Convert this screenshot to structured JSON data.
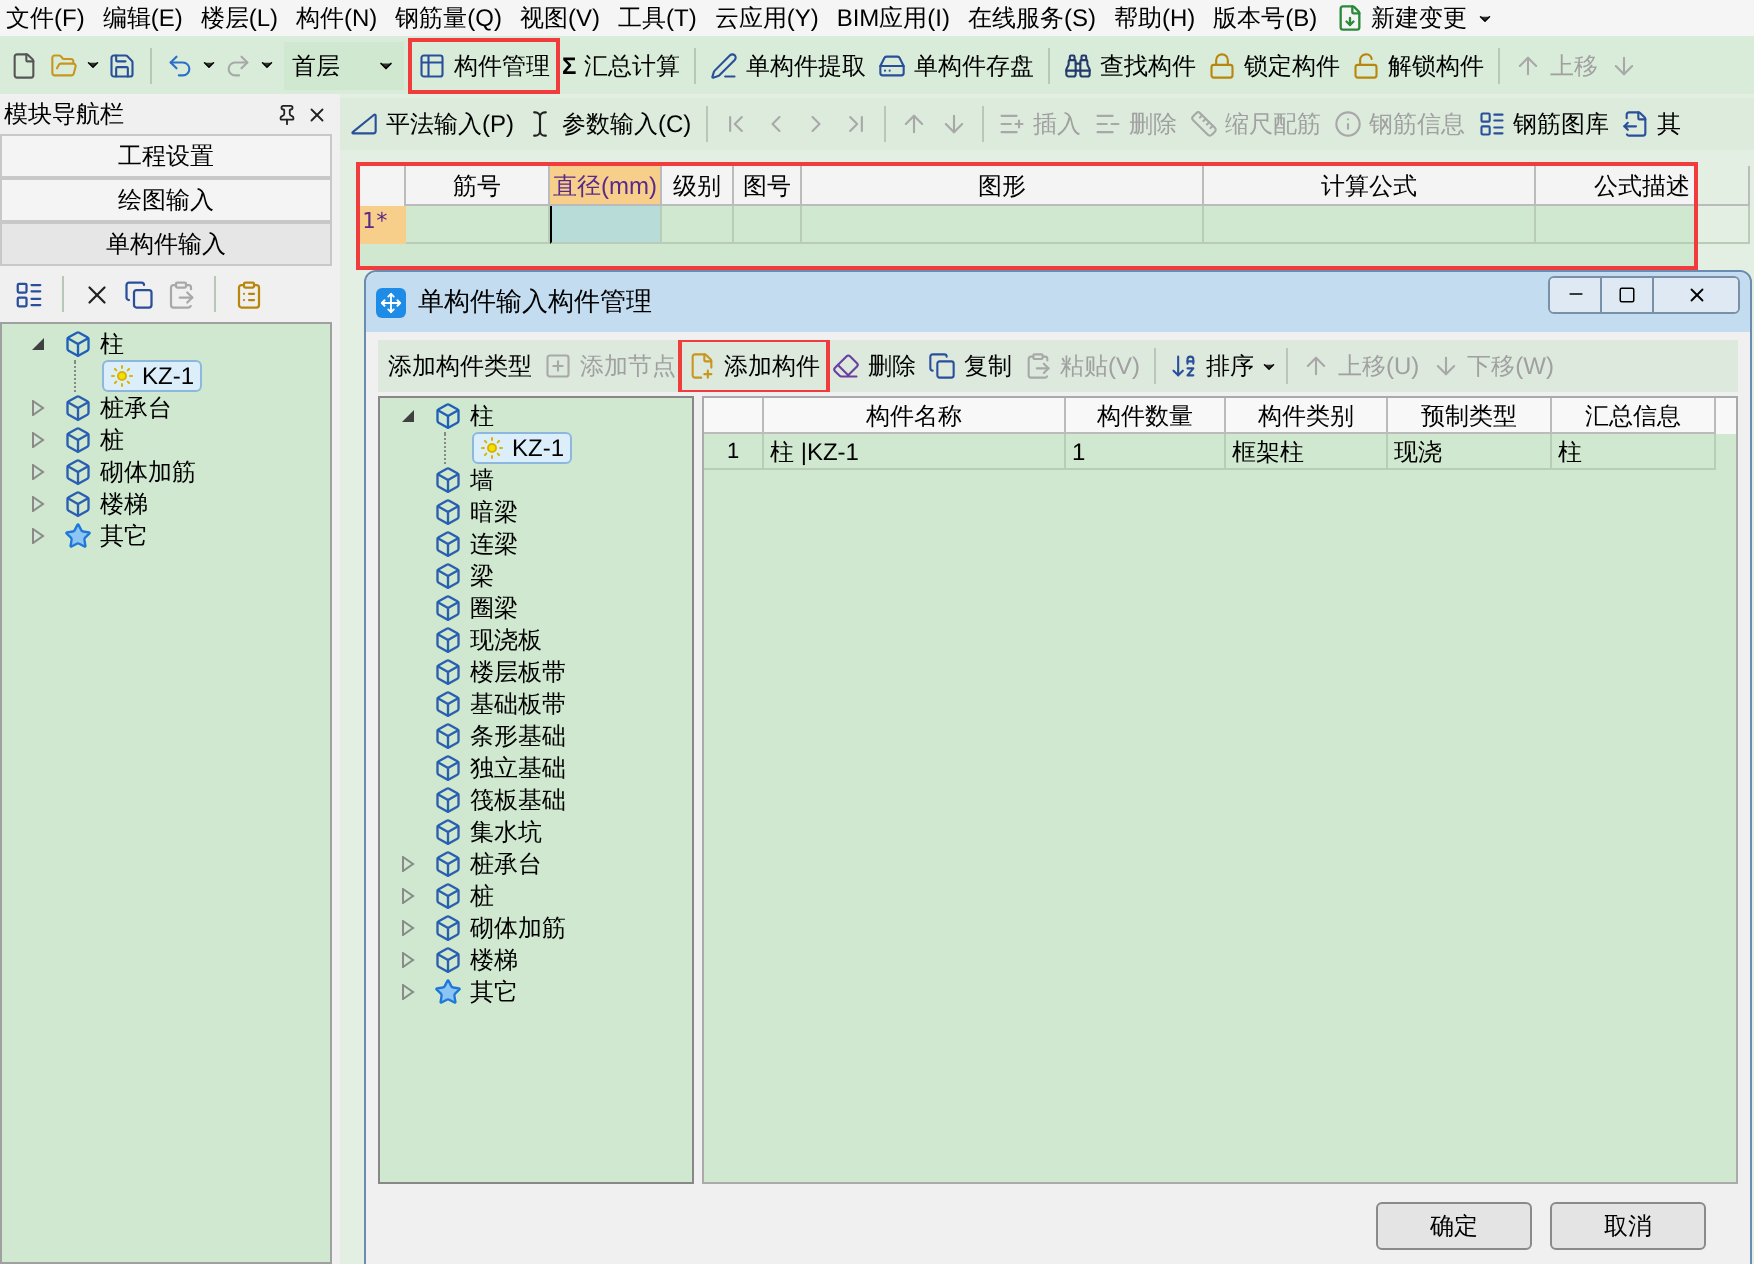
{
  "menu": [
    {
      "label": "文件(F)"
    },
    {
      "label": "编辑(E)"
    },
    {
      "label": "楼层(L)"
    },
    {
      "label": "构件(N)"
    },
    {
      "label": "钢筋量(Q)"
    },
    {
      "label": "视图(V)"
    },
    {
      "label": "工具(T)"
    },
    {
      "label": "云应用(Y)"
    },
    {
      "label": "BIM应用(I)"
    },
    {
      "label": "在线服务(S)"
    },
    {
      "label": "帮助(H)"
    },
    {
      "label": "版本号(B)"
    },
    {
      "label": "新建变更",
      "kind": "change"
    }
  ],
  "toolbar": [
    {
      "kind": "new",
      "disabled": false
    },
    {
      "kind": "open",
      "disabled": false,
      "dropdown": true
    },
    {
      "kind": "save",
      "disabled": false
    },
    {
      "kind": "sep"
    },
    {
      "kind": "undo",
      "disabled": false,
      "dropdown": true
    },
    {
      "kind": "redo",
      "disabled": true,
      "dropdown": true
    },
    {
      "kind": "floor",
      "value": "首层"
    },
    {
      "kind": "manage",
      "label": "构件管理",
      "disabled": false,
      "highlighted": true
    },
    {
      "kind": "sum",
      "icon_text": "Σ",
      "label": "汇总计算",
      "disabled": false
    },
    {
      "kind": "sep"
    },
    {
      "kind": "extract",
      "label": "单构件提取",
      "disabled": false
    },
    {
      "kind": "store",
      "label": "单构件存盘",
      "disabled": false
    },
    {
      "kind": "sep"
    },
    {
      "kind": "find",
      "label": "查找构件",
      "disabled": false
    },
    {
      "kind": "lock",
      "label": "锁定构件",
      "disabled": false
    },
    {
      "kind": "unlock",
      "label": "解锁构件",
      "disabled": false
    },
    {
      "kind": "sep"
    },
    {
      "kind": "up",
      "label": "上移",
      "disabled": true
    },
    {
      "kind": "down",
      "disabled": true
    }
  ],
  "nav_panel": {
    "title": "模块导航栏",
    "sections": [
      {
        "label": "工程设置",
        "selected": false
      },
      {
        "label": "绘图输入",
        "selected": false
      },
      {
        "label": "单构件输入",
        "selected": true
      }
    ],
    "tools": [
      {
        "kind": "list",
        "disabled": false
      },
      {
        "kind": "sep"
      },
      {
        "kind": "delete",
        "disabled": false
      },
      {
        "kind": "copy",
        "disabled": false
      },
      {
        "kind": "paste",
        "disabled": true
      },
      {
        "kind": "sep"
      },
      {
        "kind": "paste_special",
        "disabled": false
      }
    ],
    "tree": [
      {
        "label": "柱",
        "kind": "column",
        "expanded": true,
        "selected": false,
        "children": [
          {
            "label": "KZ-1",
            "kind": "item",
            "selected": true
          }
        ]
      },
      {
        "label": "桩承台",
        "kind": "element",
        "expanded": false,
        "selected": false
      },
      {
        "label": "桩",
        "kind": "element",
        "expanded": false,
        "selected": false
      },
      {
        "label": "砌体加筋",
        "kind": "element",
        "expanded": false,
        "selected": false
      },
      {
        "label": "楼梯",
        "kind": "element",
        "expanded": false,
        "selected": false
      },
      {
        "label": "其它",
        "kind": "star",
        "expanded": false,
        "selected": false
      }
    ]
  },
  "subtoolbar": [
    {
      "kind": "ruler",
      "label": "平法输入(P)",
      "disabled": false
    },
    {
      "kind": "cursor",
      "label": "参数输入(C)",
      "disabled": false
    },
    {
      "kind": "sep"
    },
    {
      "kind": "first",
      "disabled": true
    },
    {
      "kind": "prev",
      "disabled": true
    },
    {
      "kind": "next",
      "disabled": true
    },
    {
      "kind": "last",
      "disabled": true
    },
    {
      "kind": "sep"
    },
    {
      "kind": "up",
      "disabled": true
    },
    {
      "kind": "down",
      "disabled": true
    },
    {
      "kind": "sep"
    },
    {
      "kind": "insert",
      "label": "插入",
      "disabled": true
    },
    {
      "kind": "remove",
      "label": "删除",
      "disabled": true
    },
    {
      "kind": "scale",
      "label": "缩尺配筋",
      "disabled": true
    },
    {
      "kind": "info",
      "label": "钢筋信息",
      "disabled": true
    },
    {
      "kind": "library",
      "label": "钢筋图库",
      "disabled": false
    },
    {
      "kind": "other",
      "label": "其",
      "disabled": false
    }
  ],
  "rebar_grid": {
    "highlighted": true,
    "columns": [
      {
        "label": "筋号",
        "selected": false
      },
      {
        "label": "直径(mm)",
        "selected": true
      },
      {
        "label": "级别",
        "selected": false
      },
      {
        "label": "图号",
        "selected": false
      },
      {
        "label": "图形",
        "selected": false
      },
      {
        "label": "计算公式",
        "selected": false
      },
      {
        "label": "公式描述",
        "selected": false
      }
    ],
    "rows": [
      {
        "header": "1*"
      }
    ]
  },
  "dialog": {
    "title": "单构件输入构件管理",
    "toolbar": [
      {
        "kind": "addtype",
        "label": "添加构件类型",
        "disabled": false
      },
      {
        "kind": "addnode",
        "label": "添加节点",
        "disabled": true
      },
      {
        "kind": "add",
        "label": "添加构件",
        "disabled": false,
        "highlighted": true
      },
      {
        "kind": "erase",
        "label": "删除",
        "disabled": false
      },
      {
        "kind": "copy",
        "label": "复制",
        "disabled": false
      },
      {
        "kind": "paste",
        "label": "粘贴(V)",
        "disabled": true
      },
      {
        "kind": "sep"
      },
      {
        "kind": "sort",
        "label": "排序",
        "disabled": false,
        "dropdown": true
      },
      {
        "kind": "sep"
      },
      {
        "kind": "up",
        "label": "上移(U)",
        "disabled": true
      },
      {
        "kind": "down",
        "label": "下移(W)",
        "disabled": true
      }
    ],
    "tree": [
      {
        "label": "柱",
        "kind": "column",
        "expanded": true,
        "selected": false,
        "children": [
          {
            "label": "KZ-1",
            "kind": "item",
            "selected": true
          }
        ]
      },
      {
        "label": "墙",
        "kind": "element",
        "selected": false
      },
      {
        "label": "暗梁",
        "kind": "element",
        "selected": false
      },
      {
        "label": "连梁",
        "kind": "element",
        "selected": false
      },
      {
        "label": "梁",
        "kind": "element",
        "selected": false
      },
      {
        "label": "圈梁",
        "kind": "element",
        "selected": false
      },
      {
        "label": "现浇板",
        "kind": "element",
        "selected": false
      },
      {
        "label": "楼层板带",
        "kind": "element",
        "selected": false
      },
      {
        "label": "基础板带",
        "kind": "element",
        "selected": false
      },
      {
        "label": "条形基础",
        "kind": "element",
        "selected": false
      },
      {
        "label": "独立基础",
        "kind": "element",
        "selected": false
      },
      {
        "label": "筏板基础",
        "kind": "element",
        "selected": false
      },
      {
        "label": "集水坑",
        "kind": "element",
        "selected": false
      },
      {
        "label": "桩承台",
        "kind": "element",
        "expanded": false,
        "selected": false
      },
      {
        "label": "桩",
        "kind": "element",
        "expanded": false,
        "selected": false
      },
      {
        "label": "砌体加筋",
        "kind": "element",
        "expanded": false,
        "selected": false
      },
      {
        "label": "楼梯",
        "kind": "element",
        "expanded": false,
        "selected": false
      },
      {
        "label": "其它",
        "kind": "star",
        "expanded": false,
        "selected": false
      }
    ],
    "grid": {
      "columns": [
        "构件名称",
        "构件数量",
        "构件类别",
        "预制类型",
        "汇总信息"
      ],
      "rows": [
        {
          "number": "1",
          "cells": [
            "柱 |KZ-1",
            "1",
            "框架柱",
            "现浇",
            "柱"
          ]
        }
      ]
    },
    "buttons": [
      "确定",
      "取消"
    ]
  }
}
